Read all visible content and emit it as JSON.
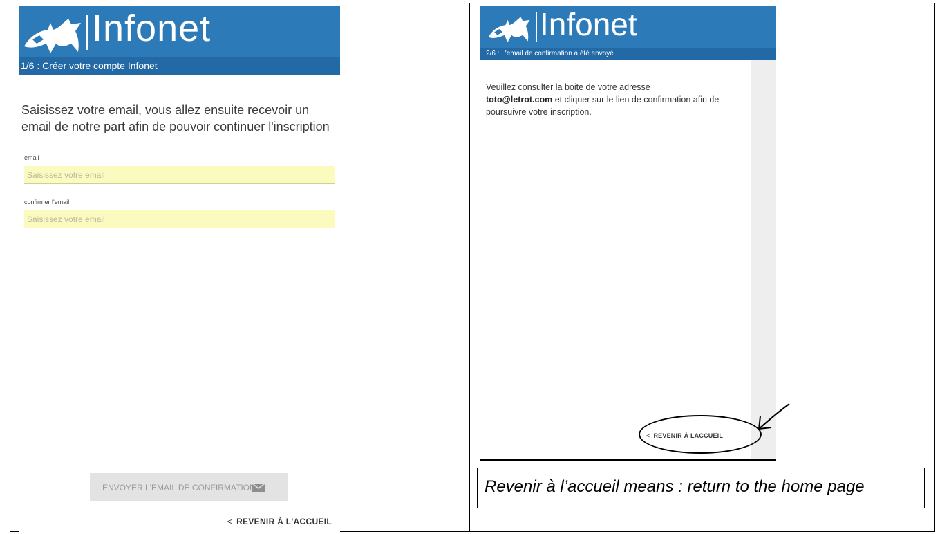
{
  "left_screen": {
    "brand": "Infonet",
    "step": "1/6 : Créer votre compte Infonet",
    "intro": "Saisissez votre email, vous allez ensuite recevoir un email de notre part afin de pouvoir continuer l'inscription",
    "email_label": "email",
    "email_placeholder": "Saisissez votre email",
    "confirm_label": "confirmer l'email",
    "confirm_placeholder": "Saisissez votre email",
    "send_button": "ENVOYER L'EMAIL DE CONFIRMATION",
    "send_icon": "mail-icon",
    "back_chevron": "<",
    "back_link": "REVENIR À L'ACCUEIL"
  },
  "right_screen": {
    "brand": "Infonet",
    "step": "2/6 : L'email de confirmation a été envoyé",
    "body_before": "Veuillez consulter la boite de votre adresse",
    "email": "toto@letrot.com",
    "body_after": "et cliquer sur le lien de confirmation afin de poursuivre votre inscription.",
    "back_chevron": "<",
    "back_link": "REVENIR À LACCUEIL"
  },
  "annotation": {
    "note": "Revenir à l’accueil means : return to the home page"
  },
  "colors": {
    "header_blue": "#2d7ab9",
    "step_bar_blue": "#2269a6",
    "input_yellow": "#fbfbc0",
    "button_gray": "#e3e3e3"
  }
}
